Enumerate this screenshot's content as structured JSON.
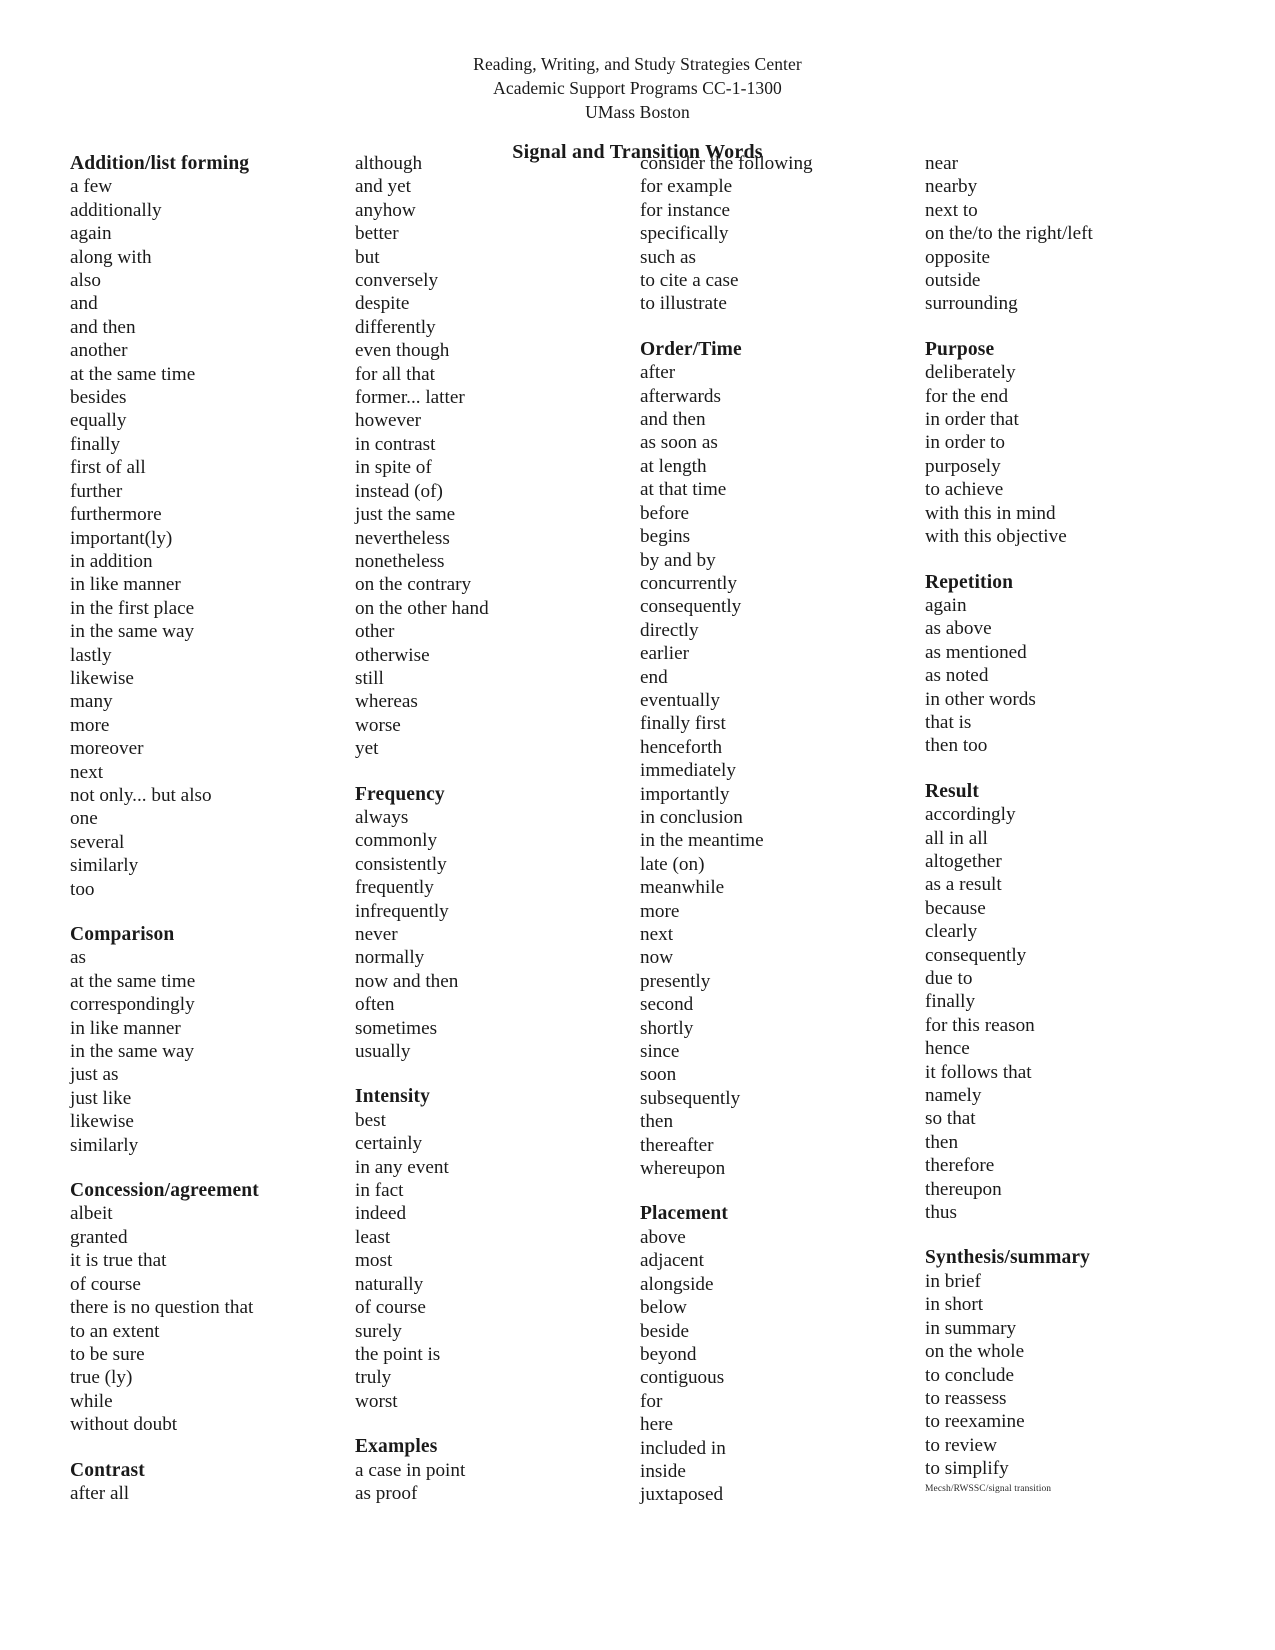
{
  "header": {
    "line1": "Reading, Writing, and Study Strategies Center",
    "line2": "Academic Support Programs   CC-1-1300",
    "line3": "UMass Boston",
    "title": "Signal and Transition Words"
  },
  "footer": {
    "note": "Mecsh/RWSSC/signal transition"
  },
  "columns": [
    {
      "groups": [
        {
          "heading": "Addition/list forming",
          "terms": [
            "a few",
            "additionally",
            "again",
            "along with",
            "also",
            "and",
            "and then",
            "another",
            "at the same time",
            "besides",
            "equally",
            "finally",
            "first of all",
            "further",
            "furthermore",
            "important(ly)",
            "in addition",
            "in like manner",
            "in the first place",
            "in the same way",
            "lastly",
            "likewise",
            "many",
            "more",
            "moreover",
            "next",
            "not only... but also",
            "one",
            "several",
            "similarly",
            "too"
          ]
        },
        {
          "heading": "Comparison",
          "terms": [
            "as",
            "at the same time",
            "correspondingly",
            "in like manner",
            "in the same way",
            "just as",
            "just like",
            "likewise",
            "similarly"
          ]
        },
        {
          "heading": "Concession/agreement",
          "terms": [
            "albeit",
            "granted",
            "it is true that",
            "of course",
            "there is no question that",
            "to an extent",
            "to be sure",
            "true (ly)",
            "while",
            "without doubt"
          ]
        },
        {
          "heading": "Contrast",
          "terms": [
            "after all"
          ]
        }
      ]
    },
    {
      "groups": [
        {
          "heading": "",
          "terms": [
            "although",
            "and yet",
            "anyhow",
            "better",
            "but",
            "conversely",
            "despite",
            "differently",
            "even though",
            "for all that",
            "former... latter",
            "however",
            "in contrast",
            "in spite of",
            "instead (of)",
            "just the same",
            "nevertheless",
            "nonetheless",
            "on the contrary",
            "on the other hand",
            "other",
            "otherwise",
            "still",
            "whereas",
            "worse",
            "yet"
          ]
        },
        {
          "heading": "Frequency",
          "terms": [
            "always",
            "commonly",
            "consistently",
            "frequently",
            "infrequently",
            "never",
            "normally",
            "now and then",
            "often",
            "sometimes",
            "usually"
          ]
        },
        {
          "heading": "Intensity",
          "terms": [
            "best",
            "certainly",
            "in any event",
            "in fact",
            "indeed",
            "least",
            "most",
            "naturally",
            "of course",
            "surely",
            "the point is",
            "truly",
            "worst"
          ]
        },
        {
          "heading": "Examples",
          "terms": [
            "a case in point",
            "as proof"
          ]
        }
      ]
    },
    {
      "groups": [
        {
          "heading": "",
          "terms": [
            "consider the following",
            "for example",
            "for instance",
            "specifically",
            "such as",
            "to cite a case",
            "to illustrate"
          ]
        },
        {
          "heading": "Order/Time",
          "terms": [
            "after",
            "afterwards",
            "and then",
            "as soon as",
            "at length",
            "at that time",
            "before",
            "begins",
            "by and by",
            "concurrently",
            "consequently",
            "directly",
            "earlier",
            "end",
            "eventually",
            "finally first",
            "henceforth",
            "immediately",
            "importantly",
            "in conclusion",
            "in the meantime",
            "late (on)",
            "meanwhile",
            "more",
            "next",
            "now",
            "presently",
            "second",
            "shortly",
            "since",
            "soon",
            "subsequently",
            "then",
            "thereafter",
            "whereupon"
          ]
        },
        {
          "heading": "Placement",
          "terms": [
            "above",
            "adjacent",
            "alongside",
            "below",
            "beside",
            "beyond",
            "contiguous",
            "for",
            "here",
            "included in",
            "inside",
            "juxtaposed"
          ]
        }
      ]
    },
    {
      "groups": [
        {
          "heading": "",
          "terms": [
            "near",
            "nearby",
            "next to",
            "on the/to the right/left",
            "opposite",
            "outside",
            "surrounding"
          ]
        },
        {
          "heading": "Purpose",
          "terms": [
            "deliberately",
            "for the end",
            "in order that",
            "in order to",
            "purposely",
            "to achieve",
            "with this in mind",
            "with this objective"
          ]
        },
        {
          "heading": "Repetition",
          "terms": [
            "again",
            "as above",
            "as mentioned",
            "as noted",
            "in other words",
            "that is",
            "then too"
          ]
        },
        {
          "heading": "Result",
          "terms": [
            "accordingly",
            "all in all",
            "altogether",
            "as a result",
            "because",
            "clearly",
            "consequently",
            "due to",
            "finally",
            "for this reason",
            "hence",
            "it follows that",
            "namely",
            "so that",
            "then",
            "therefore",
            "thereupon",
            "thus"
          ]
        },
        {
          "heading": "Synthesis/summary",
          "terms": [
            "in brief",
            "in short",
            "in summary",
            "on the whole",
            "to conclude",
            "to reassess",
            "to reexamine",
            "to review",
            "to simplify"
          ]
        }
      ]
    }
  ]
}
